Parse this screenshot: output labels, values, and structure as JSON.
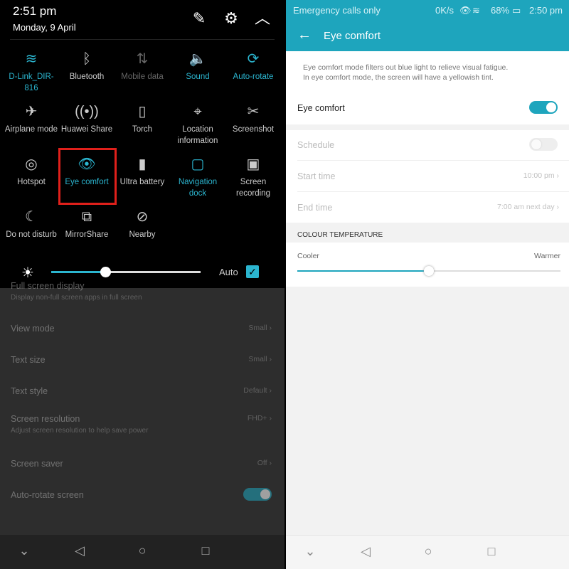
{
  "left": {
    "status": {
      "time": "2:51 pm",
      "date": "Monday, 9 April"
    },
    "top_icons": [
      "edit-icon",
      "gear-icon",
      "chevron-up-icon"
    ],
    "tiles": [
      {
        "label": "D-Link_DIR-816",
        "icon": "wifi-icon",
        "state": "on"
      },
      {
        "label": "Bluetooth",
        "icon": "bluetooth-icon",
        "state": "normal"
      },
      {
        "label": "Mobile data",
        "icon": "mobile-data-icon",
        "state": "off"
      },
      {
        "label": "Sound",
        "icon": "sound-icon",
        "state": "on"
      },
      {
        "label": "Auto-rotate",
        "icon": "auto-rotate-icon",
        "state": "on"
      },
      {
        "label": "Airplane mode",
        "icon": "airplane-icon",
        "state": "normal"
      },
      {
        "label": "Huawei Share",
        "icon": "huawei-share-icon",
        "state": "normal"
      },
      {
        "label": "Torch",
        "icon": "torch-icon",
        "state": "normal"
      },
      {
        "label": "Location information",
        "icon": "location-icon",
        "state": "normal"
      },
      {
        "label": "Screenshot",
        "icon": "screenshot-icon",
        "state": "normal"
      },
      {
        "label": "Hotspot",
        "icon": "hotspot-icon",
        "state": "normal"
      },
      {
        "label": "Eye comfort",
        "icon": "eye-icon",
        "state": "on"
      },
      {
        "label": "Ultra battery",
        "icon": "battery-icon",
        "state": "normal"
      },
      {
        "label": "Navigation dock",
        "icon": "navigation-dock-icon",
        "state": "on"
      },
      {
        "label": "Screen recording",
        "icon": "screen-recording-icon",
        "state": "normal"
      },
      {
        "label": "Do not disturb",
        "icon": "moon-icon",
        "state": "normal"
      },
      {
        "label": "MirrorShare",
        "icon": "mirrorshare-icon",
        "state": "normal"
      },
      {
        "label": "Nearby",
        "icon": "nearby-icon",
        "state": "normal"
      }
    ],
    "brightness": {
      "percent": 36,
      "auto_label": "Auto",
      "auto_checked": true
    },
    "settings": [
      {
        "label": "Full screen display",
        "sub": "Display non-full screen apps in full screen",
        "value": ""
      },
      {
        "label": "View mode",
        "value": "Small"
      },
      {
        "label": "Text size",
        "value": "Small"
      },
      {
        "label": "Text style",
        "value": "Default"
      },
      {
        "label": "Screen resolution",
        "sub": "Adjust screen resolution to help save power",
        "value": "FHD+"
      },
      {
        "label": "Screen saver",
        "value": "Off"
      },
      {
        "label": "Auto-rotate screen",
        "toggle": true
      }
    ]
  },
  "right": {
    "status": {
      "carrier": "Emergency calls only",
      "speed": "0K/s",
      "battery": "68%",
      "time": "2:50 pm"
    },
    "title": "Eye comfort",
    "description": [
      "Eye comfort mode filters out blue light to relieve visual fatigue.",
      "In eye comfort mode, the screen will have a yellowish tint."
    ],
    "eye_comfort": {
      "label": "Eye comfort",
      "on": true
    },
    "schedule": {
      "label": "Schedule",
      "on": false
    },
    "start_time": {
      "label": "Start time",
      "value": "10:00 pm"
    },
    "end_time": {
      "label": "End time",
      "value": "7:00 am next day"
    },
    "colour_temperature": {
      "heading": "COLOUR TEMPERATURE",
      "min_label": "Cooler",
      "max_label": "Warmer",
      "percent": 50
    }
  },
  "colors": {
    "accent": "#2bb5cf",
    "header": "#1ea5bd",
    "highlight": "#e0201b"
  }
}
